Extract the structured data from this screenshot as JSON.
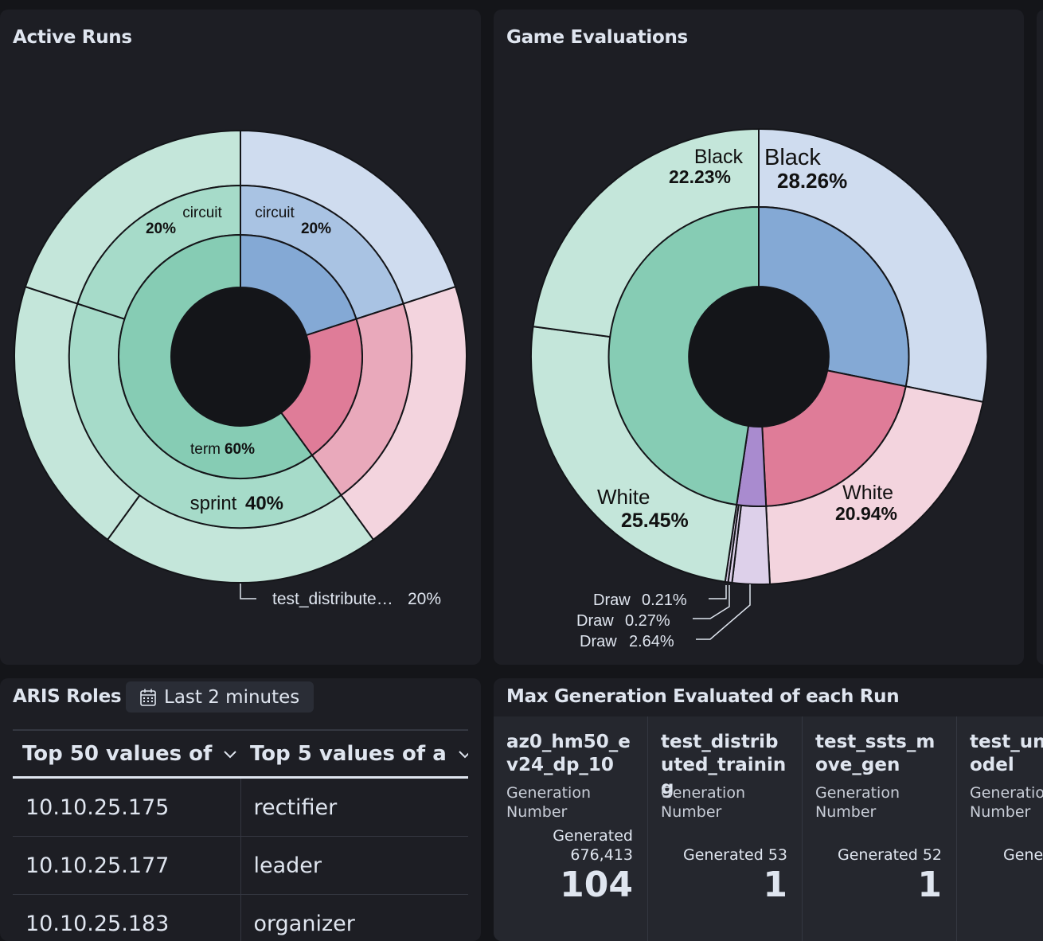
{
  "panels": {
    "active_runs": {
      "title": "Active Runs",
      "labels": {
        "circuit_left": "circuit",
        "circuit_left_pct": "20%",
        "circuit_right": "circuit",
        "circuit_right_pct": "20%",
        "term": "term",
        "term_pct": "60%",
        "sprint": "sprint",
        "sprint_pct": "40%",
        "test_distributed": "test_distribute…",
        "test_distributed_pct": "20%"
      }
    },
    "game_evaluations": {
      "title": "Game Evaluations",
      "labels": {
        "black_left": "Black",
        "black_left_pct": "22.23%",
        "black_right": "Black",
        "black_right_pct": "28.26%",
        "white_left": "White",
        "white_left_pct": "25.45%",
        "white_right": "White",
        "white_right_pct": "20.94%",
        "draw1": "Draw",
        "draw1_pct": "0.21%",
        "draw2": "Draw",
        "draw2_pct": "0.27%",
        "draw3": "Draw",
        "draw3_pct": "2.64%"
      }
    },
    "aris_roles": {
      "title": "ARIS Roles",
      "time_badge": "Last 2 minutes",
      "columns": [
        "Top 50 values of",
        "Top 5 values of a"
      ],
      "rows": [
        [
          "10.10.25.175",
          "rectifier"
        ],
        [
          "10.10.25.177",
          "leader"
        ],
        [
          "10.10.25.183",
          "organizer"
        ]
      ]
    },
    "max_generation": {
      "title": "Max Generation Evaluated of each Run",
      "metrics": [
        {
          "title": "az0_hm50_ev24_dp_10",
          "subtitle": "Generation Number",
          "generated": "Generated 676,413",
          "value": "104"
        },
        {
          "title": "test_distributed_training",
          "subtitle": "Generation Number",
          "generated": "Generated 53",
          "value": "1"
        },
        {
          "title": "test_ssts_move_gen",
          "subtitle": "Generation Number",
          "generated": "Generated 52",
          "value": "1"
        },
        {
          "title": "test_unet_model",
          "subtitle": "Generation Number",
          "generated": "Generated",
          "value": ""
        }
      ]
    }
  },
  "colors": {
    "background": "#141519",
    "panel": "#1d1e24",
    "green_inner": "#86ccb4",
    "green_mid": "#a6dbc9",
    "green_outer": "#c4e6da",
    "blue_inner": "#84a9d5",
    "blue_mid": "#a9c3e3",
    "blue_outer": "#cfdcef",
    "pink_inner": "#df7c98",
    "pink_mid": "#e9a9bb",
    "pink_outer": "#f3d4de",
    "purple_inner": "#a98bcf",
    "purple_outer": "#ddd0ea"
  },
  "icons": [
    "calendar-icon",
    "chevron-down-icon"
  ]
}
